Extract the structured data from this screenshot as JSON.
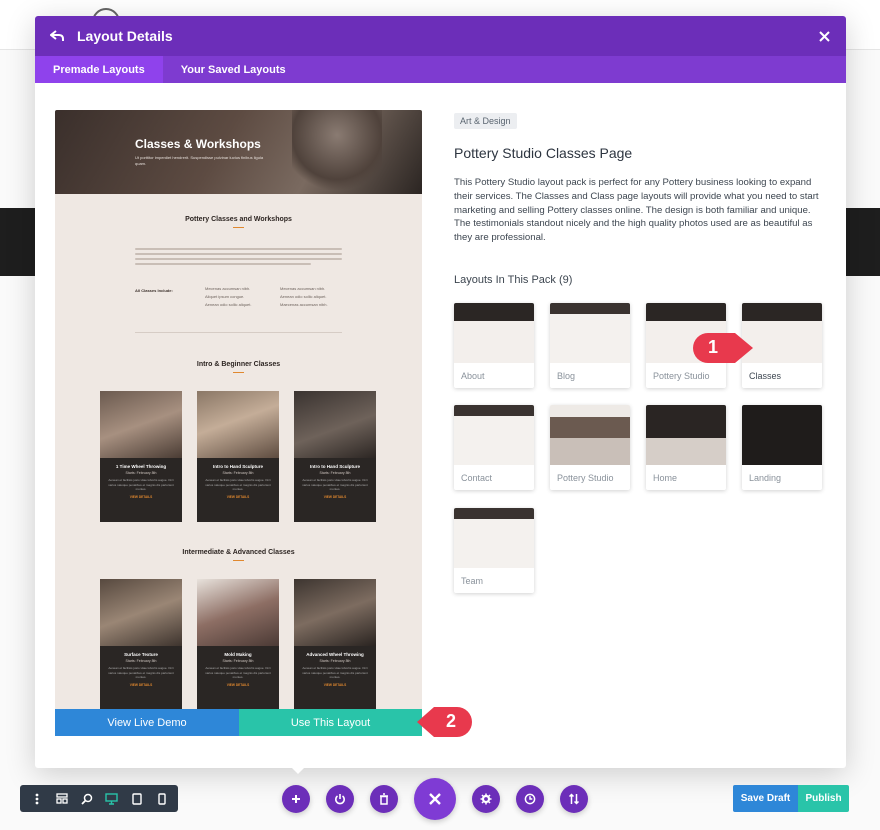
{
  "modal": {
    "title": "Layout Details",
    "tabs": [
      {
        "label": "Premade Layouts",
        "active": true
      },
      {
        "label": "Your Saved Layouts",
        "active": false
      }
    ]
  },
  "preview": {
    "hero_title": "Classes & Workshops",
    "hero_subtitle": "Ut porttitor imperdiet hendrerit. Suspendisse pulvinar luctus finibus ligula quam.",
    "section1_title": "Pottery Classes and Workshops",
    "all_classes_label": "All Classes Include:",
    "bullets_left": [
      "Mecenas accumsan nibh.",
      "Aliquet ipsum congue.",
      "Aenean odio sollic aliquet."
    ],
    "bullets_right": [
      "Mecenas accumsan nibh.",
      "Aenean odio sollic aliquet.",
      "Maecenas accumsan nibh."
    ],
    "section2_title": "Intro & Beginner Classes",
    "section3_title": "Intermediate & Advanced Classes",
    "card_date": "Starts: February 8th",
    "card_text": "Aenean et facilisis justo vitae lobortis augue. Orci varius natoque penatibus et magnis dis parturient montes.",
    "card_link": "VIEW DETAILS",
    "cards_row1": [
      "1 Time Wheel Throwing",
      "Intro to Hand Sculpture",
      "Intro to Hand Sculpture"
    ],
    "cards_row2": [
      "Surface Texture",
      "Mold Making",
      "Advanced Wheel Throwing"
    ]
  },
  "buttons": {
    "demo": "View Live Demo",
    "use": "Use This Layout"
  },
  "info": {
    "category": "Art & Design",
    "title": "Pottery Studio Classes Page",
    "description": "This Pottery Studio layout pack is perfect for any Pottery business looking to expand their services. The Classes and Class page layouts will provide what you need to start marketing and selling Pottery classes online. The design is both familiar and unique. The testimonials standout nicely and the high quality photos used are as beautiful as they are professional.",
    "pack_title": "Layouts In This Pack (9)",
    "layouts": [
      {
        "label": "About",
        "selected": false
      },
      {
        "label": "Blog",
        "selected": false
      },
      {
        "label": "Pottery Studio",
        "selected": false
      },
      {
        "label": "Classes",
        "selected": true
      },
      {
        "label": "Contact",
        "selected": false
      },
      {
        "label": "Pottery Studio",
        "selected": false
      },
      {
        "label": "Home",
        "selected": false
      },
      {
        "label": "Landing",
        "selected": false
      },
      {
        "label": "Team",
        "selected": false
      }
    ]
  },
  "annotations": {
    "marker1": "1",
    "marker2": "2"
  },
  "bottom": {
    "save_draft": "Save Draft",
    "publish": "Publish"
  },
  "colors": {
    "header": "#6c2eb9",
    "tabs": "#7e3bd0",
    "blue": "#2e87d8",
    "teal": "#29c4a9",
    "marker": "#e8394d"
  }
}
